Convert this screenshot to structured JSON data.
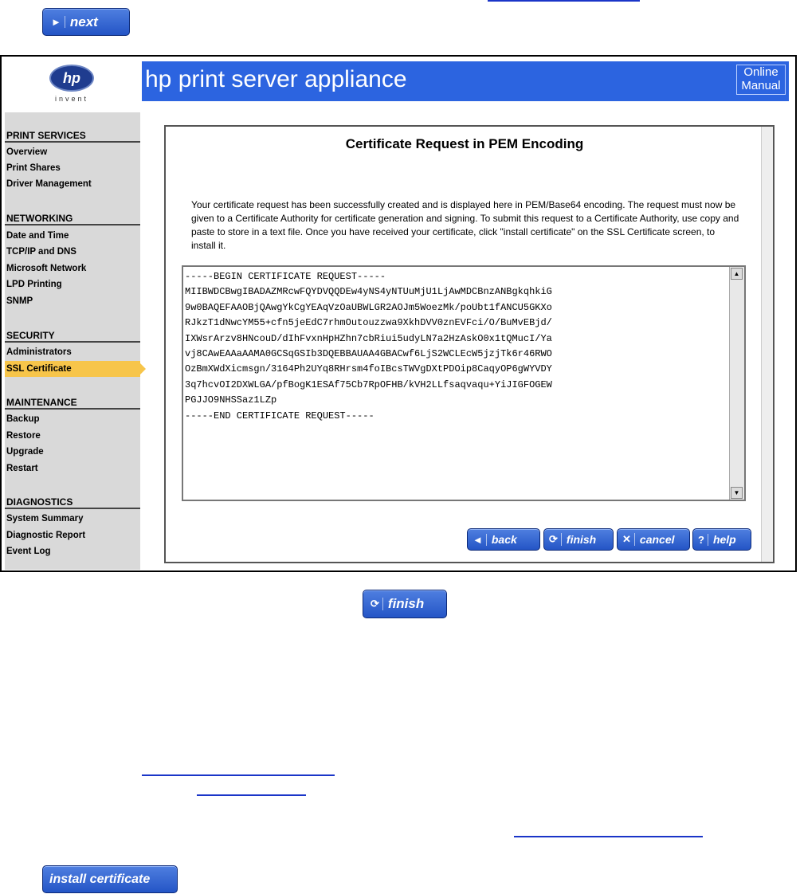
{
  "top_next_button": {
    "label": "next",
    "icon": "chevron-right-icon"
  },
  "bottom_finish_button": {
    "label": "finish",
    "icon": "rotate-icon"
  },
  "install_button": {
    "label": "install certificate"
  },
  "header": {
    "title": "hp print server appliance",
    "logo_text": "hp",
    "logo_tagline": "invent",
    "online_manual": "Online Manual"
  },
  "sidebar": {
    "sections": [
      {
        "title": "PRINT SERVICES",
        "items": [
          "Overview",
          "Print Shares",
          "Driver Management"
        ]
      },
      {
        "title": "NETWORKING",
        "items": [
          "Date and Time",
          "TCP/IP and DNS",
          "Microsoft Network",
          "LPD Printing",
          "SNMP"
        ]
      },
      {
        "title": "SECURITY",
        "items": [
          "Administrators",
          "SSL Certificate"
        ]
      },
      {
        "title": "MAINTENANCE",
        "items": [
          "Backup",
          "Restore",
          "Upgrade",
          "Restart"
        ]
      },
      {
        "title": "DIAGNOSTICS",
        "items": [
          "System Summary",
          "Diagnostic Report",
          "Event Log"
        ]
      }
    ],
    "active_item": "SSL Certificate"
  },
  "panel": {
    "title": "Certificate Request in PEM Encoding",
    "description": "Your certificate request has been successfully created and is displayed here in PEM/Base64 encoding. The request must now be given to a Certificate Authority for certificate generation and signing. To submit this request to a Certificate Authority, use copy and paste to store in a text file. Once you have received your certificate, click \"install certificate\" on the SSL Certificate screen, to install it.",
    "certificate": "-----BEGIN CERTIFICATE REQUEST-----\nMIIBWDCBwgIBADAZMRcwFQYDVQQDEw4yNS4yNTUuMjU1LjAwMDCBnzANBgkqhkiG\n9w0BAQEFAAOBjQAwgYkCgYEAqVzOaUBWLGR2AOJm5WoezMk/poUbt1fANCU5GKXo\nRJkzT1dNwcYM55+cfn5jeEdC7rhmOutouzzwa9XkhDVV0znEVFci/O/BuMvEBjd/\nIXWsrArzv8HNcouD/dIhFvxnHpHZhn7cbRiui5udyLN7a2HzAskO0x1tQMucI/Ya\nvj8CAwEAAaAAMA0GCSqGSIb3DQEBBAUAA4GBACwf6LjS2WCLEcW5jzjTk6r46RWO\nOzBmXWdXicmsgn/3164Ph2UYq8RHrsm4foIBcsTWVgDXtPDOip8CaqyOP6gWYVDY\n3q7hcvOI2DXWLGA/pfBogK1ESAf75Cb7RpOFHB/kVH2LLfsaqvaqu+YiJIGFOGEW\nPGJJO9NHSSaz1LZp\n-----END CERTIFICATE REQUEST-----",
    "buttons": {
      "back": "back",
      "finish": "finish",
      "cancel": "cancel",
      "help": "help"
    }
  },
  "colors": {
    "header_blue": "#2c64e0",
    "button_blue": "#2d5fd0",
    "active_highlight": "#f7c54a",
    "sidebar_gray": "#d9d9d9",
    "link_blue": "#1a35c8"
  }
}
